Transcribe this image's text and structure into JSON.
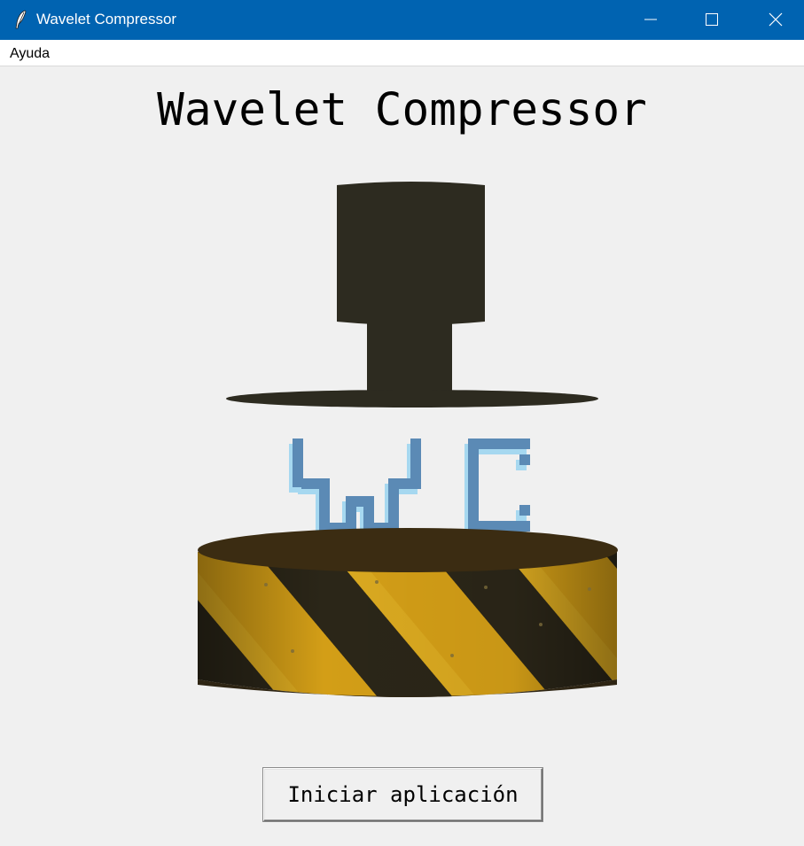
{
  "window": {
    "title": "Wavelet Compressor",
    "icon": "feather-icon",
    "controls": [
      "minimize-icon",
      "maximize-icon",
      "close-icon"
    ],
    "titlebar_color": "#0063b1"
  },
  "menubar": {
    "items": [
      {
        "label": "Ayuda"
      }
    ]
  },
  "main": {
    "title": "Wavelet Compressor",
    "logo": {
      "text": "WC",
      "description_icon": "hydraulic-press-icon"
    },
    "start_button": {
      "label": "Iniciar aplicación"
    }
  }
}
